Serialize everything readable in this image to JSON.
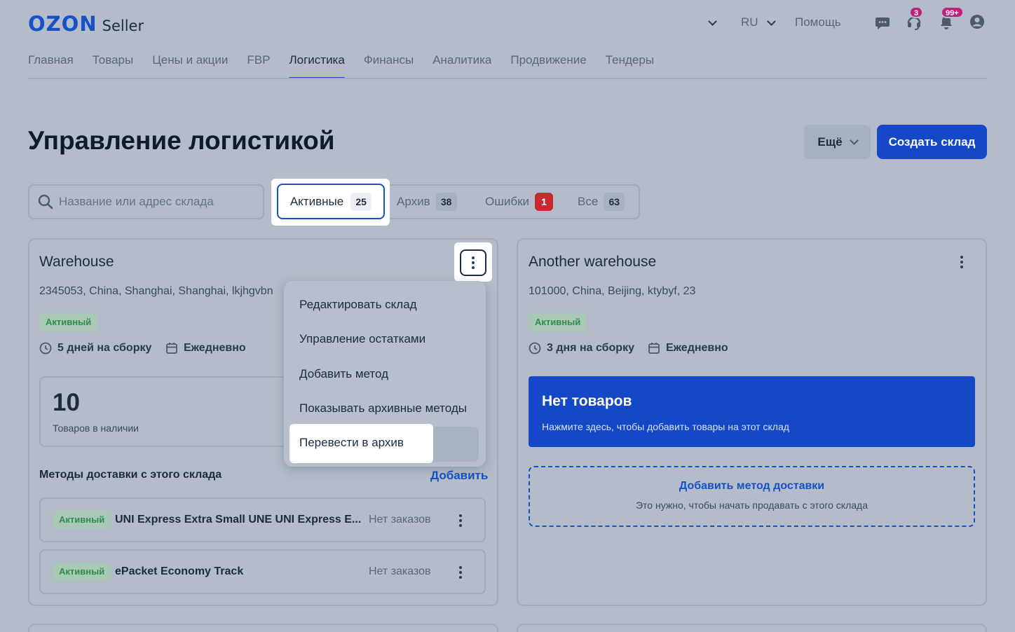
{
  "header": {
    "logo_brand": "OZON",
    "logo_product": "Seller",
    "language": "RU",
    "help": "Помощь",
    "support_badge": "3",
    "notifications_badge": "99+"
  },
  "nav": {
    "items": [
      {
        "label": "Главная"
      },
      {
        "label": "Товары"
      },
      {
        "label": "Цены и акции"
      },
      {
        "label": "FBP"
      },
      {
        "label": "Логистика"
      },
      {
        "label": "Финансы"
      },
      {
        "label": "Аналитика"
      },
      {
        "label": "Продвижение"
      },
      {
        "label": "Тендеры"
      }
    ],
    "active_index": 4
  },
  "page": {
    "title": "Управление логистикой",
    "more_button": "Ещё",
    "create_button": "Создать склад"
  },
  "search": {
    "placeholder": "Название или адрес склада",
    "value": ""
  },
  "filters": {
    "active": {
      "label": "Активные",
      "count": "25"
    },
    "archive": {
      "label": "Архив",
      "count": "38"
    },
    "errors": {
      "label": "Ошибки",
      "count": "1"
    },
    "all": {
      "label": "Все",
      "count": "63"
    }
  },
  "warehouses": [
    {
      "name": "Warehouse",
      "address": "2345053, China, Shanghai, Shanghai, lkjhgvbn",
      "status": "Активный",
      "assembly_time": "5 дней на сборку",
      "schedule": "Ежедневно",
      "stock_count": "10",
      "stock_label": "Товаров в наличии",
      "methods_title": "Методы доставки с этого склада",
      "add_label": "Добавить",
      "methods": [
        {
          "status": "Активный",
          "name": "UNI Express Extra Small UNE UNI Express E...",
          "orders": "Нет заказов"
        },
        {
          "status": "Активный",
          "name": "ePacket Economy Track",
          "orders": "Нет заказов"
        }
      ]
    },
    {
      "name": "Another warehouse",
      "address": "101000, China, Beijing, ktybyf, 23",
      "status": "Активный",
      "assembly_time": "3 дня на сборку",
      "schedule": "Ежедневно",
      "no_goods_title": "Нет товаров",
      "no_goods_text": "Нажмите здесь, чтобы добавить товары на этот склад",
      "add_method_title": "Добавить метод доставки",
      "add_method_text": "Это нужно, чтобы начать продавать с этого склада"
    }
  ],
  "context_menu": {
    "items": [
      {
        "label": "Редактировать склад"
      },
      {
        "label": "Управление остатками"
      },
      {
        "label": "Добавить метод"
      },
      {
        "label": "Показывать архивные методы"
      },
      {
        "label": "Перевести в архив"
      }
    ]
  },
  "colors": {
    "accent": "#1651c8",
    "primary_button": "#1448c7",
    "error_badge": "#c8282e",
    "status_text": "#2f8b4f",
    "notification_badge": "#c21f7a"
  },
  "icons": [
    "search-icon",
    "chevron-down-icon",
    "chat-icon",
    "support-icon",
    "bell-icon",
    "profile-icon",
    "clock-icon",
    "calendar-icon",
    "kebab-icon"
  ]
}
